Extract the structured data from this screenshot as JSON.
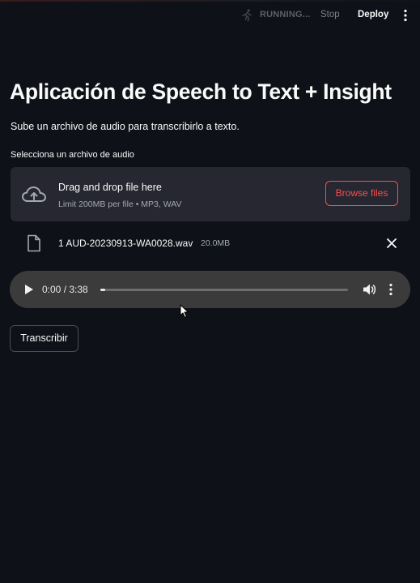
{
  "header": {
    "status_text": "RUNNING...",
    "status_icon": "running-icon",
    "stop_label": "Stop",
    "deploy_label": "Deploy",
    "menu_icon": "vertical-ellipsis-icon"
  },
  "main": {
    "title": "Aplicación de Speech to Text + Insight",
    "subtitle": "Sube un archivo de audio para transcribirlo a texto."
  },
  "uploader": {
    "label": "Selecciona un archivo de audio",
    "dropzone_title": "Drag and drop file here",
    "dropzone_limit": "Limit 200MB per file • MP3, WAV",
    "browse_label": "Browse files",
    "upload_icon": "cloud-upload-icon"
  },
  "file": {
    "name": "1 AUD-20230913-WA0028.wav",
    "size": "20.0MB",
    "icon": "file-icon",
    "remove_icon": "close-icon"
  },
  "audio": {
    "time_display": "0:00 / 3:38",
    "progress": 0.02,
    "play_icon": "play-icon",
    "volume_icon": "volume-icon",
    "more_icon": "vertical-ellipsis-icon"
  },
  "actions": {
    "transcribe_label": "Transcribir"
  },
  "colors": {
    "background": "#0e1117",
    "panel": "#262730",
    "accent": "#ff4b4b",
    "text": "#fafafa",
    "muted": "#a3a8b4",
    "player": "#3b3b3b"
  }
}
